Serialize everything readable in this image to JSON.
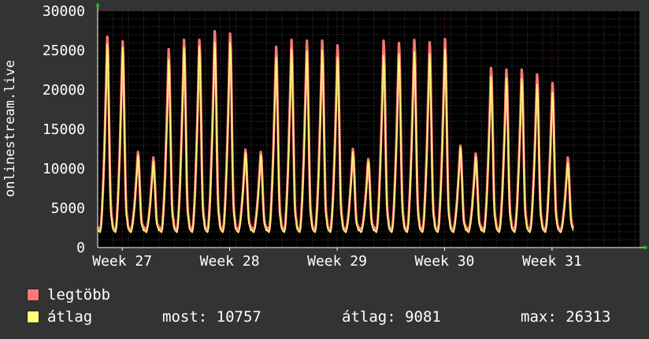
{
  "chart_data": {
    "type": "line",
    "title": "",
    "ylabel": "onlinestream.live",
    "xlabel": "",
    "ylim": [
      0,
      30000
    ],
    "yticks": [
      0,
      5000,
      10000,
      15000,
      20000,
      25000,
      30000
    ],
    "xticks": [
      "Week 27",
      "Week 28",
      "Week 29",
      "Week 30",
      "Week 31"
    ],
    "grid": true,
    "legend_position": "bottom-left",
    "x_unit": "days",
    "x_range": [
      0,
      35.3
    ],
    "xtick_positions": [
      1.6,
      8.6,
      15.6,
      22.6,
      29.6
    ],
    "daily_peaks_max": [
      26900,
      26300,
      12200,
      11500,
      25300,
      26500,
      26500,
      27600,
      27300,
      12500,
      12200,
      25600,
      26500,
      26400,
      26400,
      25800,
      12600,
      11300,
      26400,
      26100,
      26500,
      26200,
      26600,
      13000,
      12000,
      22900,
      22700,
      22700,
      22100,
      21000,
      11500
    ],
    "daily_peaks_avg": [
      26000,
      25500,
      11800,
      11000,
      24000,
      25500,
      25700,
      26200,
      26200,
      12100,
      11800,
      24300,
      25300,
      25100,
      25200,
      24300,
      12200,
      11000,
      24500,
      24700,
      25000,
      24700,
      25300,
      12800,
      11600,
      21800,
      21600,
      21500,
      20800,
      19800,
      10800
    ],
    "series": [
      {
        "name": "legtöbb",
        "color": "#ff7777"
      },
      {
        "name": "átlag",
        "color": "#ffff77"
      }
    ],
    "stats": {
      "most_label": "most:",
      "most_value": "10757",
      "atlag_label": "átlag:",
      "atlag_value": "9081",
      "max_label": "max:",
      "max_value": "26313"
    },
    "colors": {
      "background": "#333333",
      "plot_background": "#000000",
      "grid": "#444444",
      "major_grid": "#6a2424",
      "axis": "#ffffff",
      "arrow": "#00cc00"
    }
  }
}
